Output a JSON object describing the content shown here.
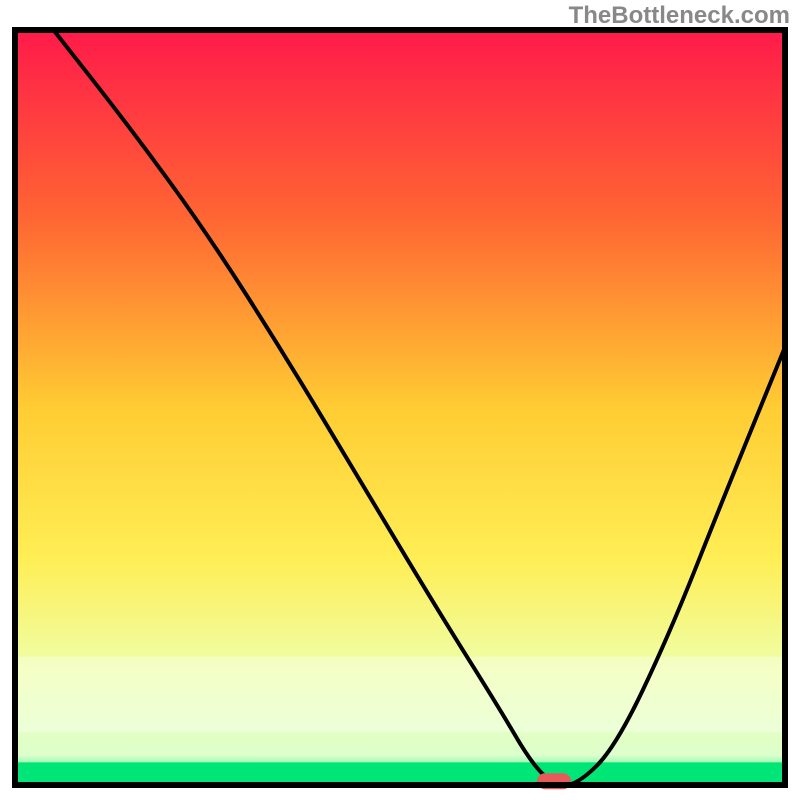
{
  "watermark": "TheBottleneck.com",
  "chart_data": {
    "type": "line",
    "title": "",
    "xlabel": "",
    "ylabel": "",
    "xlim": [
      0,
      100
    ],
    "ylim": [
      0,
      100
    ],
    "background_gradient": {
      "stops": [
        {
          "offset": 0,
          "color": "#ff1a4a"
        },
        {
          "offset": 25,
          "color": "#ff6633"
        },
        {
          "offset": 50,
          "color": "#ffcc33"
        },
        {
          "offset": 70,
          "color": "#ffee55"
        },
        {
          "offset": 85,
          "color": "#eeffaa"
        },
        {
          "offset": 96,
          "color": "#ddffcc"
        },
        {
          "offset": 100,
          "color": "#00e676"
        }
      ]
    },
    "green_band": {
      "from_y": 97,
      "to_y": 100,
      "color": "#00e676"
    },
    "white_band": {
      "from_y": 83,
      "to_y": 93
    },
    "curve": {
      "description": "bottleneck curve descending from top-left, reaching minimum near x=70, then rising",
      "x": [
        5,
        15,
        25,
        35,
        45,
        55,
        63,
        67,
        70,
        73,
        78,
        85,
        92,
        100
      ],
      "y": [
        0,
        13,
        27,
        43,
        60,
        77,
        90,
        97,
        100,
        100,
        95,
        80,
        62,
        42
      ]
    },
    "marker": {
      "x": 70,
      "y": 99.5,
      "color": "#e85a5a",
      "shape": "pill"
    },
    "border": {
      "color": "#000000",
      "width": 6
    }
  }
}
